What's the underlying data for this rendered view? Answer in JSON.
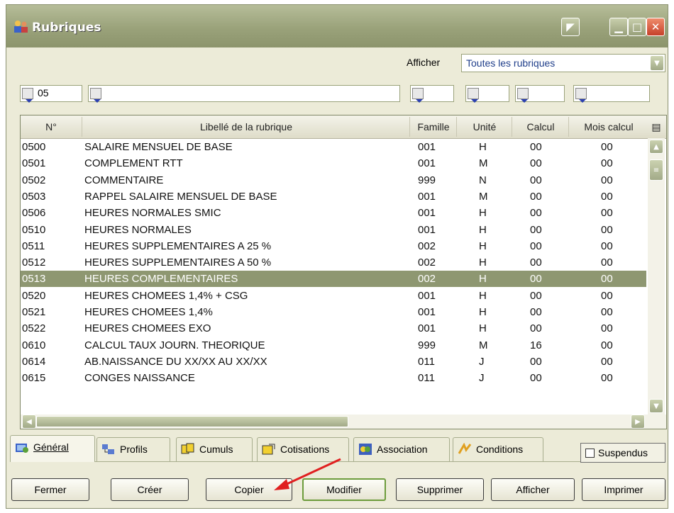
{
  "window": {
    "title": "Rubriques",
    "controls": [
      "restore",
      "minimize",
      "maximize",
      "close"
    ]
  },
  "toolbar": {
    "afficher_label": "Afficher",
    "afficher_value": "Toutes les rubriques",
    "filters": [
      "05",
      "",
      "",
      "",
      "",
      ""
    ]
  },
  "table": {
    "columns": [
      "N°",
      "Libellé de la rubrique",
      "Famille",
      "Unité",
      "Calcul",
      "Mois calcul"
    ],
    "rows": [
      [
        "0500",
        "SALAIRE MENSUEL DE BASE",
        "001",
        "H",
        "00",
        "00"
      ],
      [
        "0501",
        "COMPLEMENT RTT",
        "001",
        "M",
        "00",
        "00"
      ],
      [
        "0502",
        "COMMENTAIRE",
        "999",
        "N",
        "00",
        "00"
      ],
      [
        "0503",
        "RAPPEL SALAIRE MENSUEL DE BASE",
        "001",
        "M",
        "00",
        "00"
      ],
      [
        "0506",
        "HEURES NORMALES SMIC",
        "001",
        "H",
        "00",
        "00"
      ],
      [
        "0510",
        "HEURES NORMALES",
        "001",
        "H",
        "00",
        "00"
      ],
      [
        "0511",
        "HEURES SUPPLEMENTAIRES A 25 %",
        "002",
        "H",
        "00",
        "00"
      ],
      [
        "0512",
        "HEURES SUPPLEMENTAIRES A 50 %",
        "002",
        "H",
        "00",
        "00"
      ],
      [
        "0513",
        "HEURES COMPLEMENTAIRES",
        "002",
        "H",
        "00",
        "00"
      ],
      [
        "0520",
        "HEURES CHOMEES 1,4% + CSG",
        "001",
        "H",
        "00",
        "00"
      ],
      [
        "0521",
        "HEURES CHOMEES 1,4%",
        "001",
        "H",
        "00",
        "00"
      ],
      [
        "0522",
        "HEURES CHOMEES EXO",
        "001",
        "H",
        "00",
        "00"
      ],
      [
        "0610",
        "CALCUL TAUX JOURN. THEORIQUE",
        "999",
        "M",
        "16",
        "00"
      ],
      [
        "0614",
        "AB.NAISSANCE DU XX/XX AU XX/XX",
        "011",
        "J",
        "00",
        "00"
      ],
      [
        "0615",
        "CONGES NAISSANCE",
        "011",
        "J",
        "00",
        "00"
      ]
    ],
    "selected_index": 8
  },
  "tabs": [
    "Général",
    "Profils",
    "Cumuls",
    "Cotisations",
    "Association",
    "Conditions"
  ],
  "suspendus_label": "Suspendus",
  "buttons": [
    "Fermer",
    "Créer",
    "Copier",
    "Modifier",
    "Supprimer",
    "Afficher",
    "Imprimer"
  ],
  "colors": {
    "title_bar": "#9aa27a",
    "selected_row": "#8e9771",
    "annotation_arrow": "#e02020"
  }
}
